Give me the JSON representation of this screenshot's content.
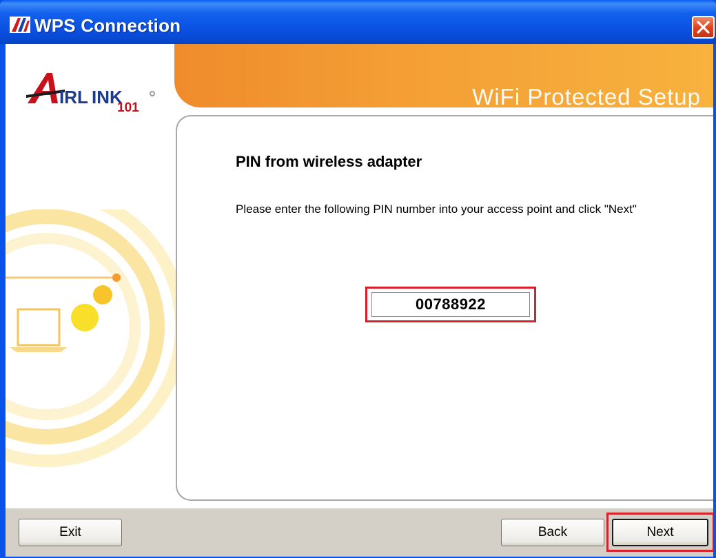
{
  "window": {
    "title": "WPS Connection",
    "close_icon": "close-icon"
  },
  "banner": {
    "brand_text": "WiFi Protected Setup",
    "logo_text_main": "IRLINK",
    "logo_text_sub": "101",
    "colors": {
      "orange_start": "#ef8b2c",
      "orange_end": "#f8b23e"
    }
  },
  "content": {
    "heading": "PIN from wireless adapter",
    "description": "Please enter the following PIN number into your access point and click \"Next\"",
    "pin": "00788922"
  },
  "buttons": {
    "exit": "Exit",
    "back": "Back",
    "next": "Next"
  },
  "colors": {
    "titlebar": "#0a53e8",
    "highlight": "#d8202a",
    "button_bar": "#d4d0c8"
  }
}
